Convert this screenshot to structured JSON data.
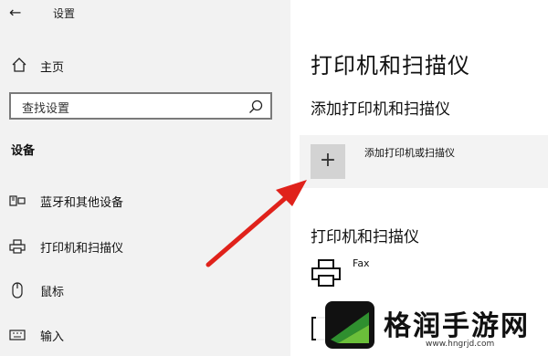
{
  "window": {
    "title": "设置"
  },
  "sidebar": {
    "home_label": "主页",
    "search_placeholder": "查找设置",
    "section_label": "设备",
    "items": [
      {
        "label": "蓝牙和其他设备",
        "icon": "devices-icon"
      },
      {
        "label": "打印机和扫描仪",
        "icon": "printer-icon"
      },
      {
        "label": "鼠标",
        "icon": "mouse-icon"
      },
      {
        "label": "输入",
        "icon": "keyboard-icon"
      }
    ]
  },
  "main": {
    "title": "打印机和扫描仪",
    "add_section_title": "添加打印机和扫描仪",
    "add_button_label": "添加打印机或扫描仪",
    "printers_section_title": "打印机和扫描仪",
    "printers": [
      {
        "name": "Fax",
        "icon": "printer-icon"
      }
    ]
  },
  "watermark": {
    "brand": "格润手游网",
    "url": "www.hngrjd.com"
  },
  "colors": {
    "sidebar_bg": "#f2f2f2",
    "arrow": "#e0221b",
    "logo_green": "#2f8f2f"
  }
}
